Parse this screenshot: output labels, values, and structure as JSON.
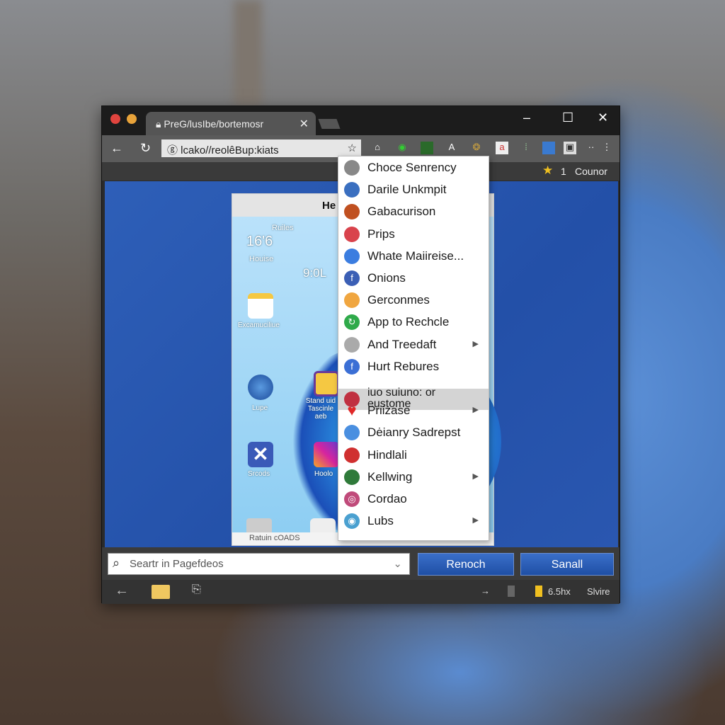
{
  "browser": {
    "tab_title": "PreG/lusIbe/bortemosr",
    "url": "lcako//reolêBup:kiats",
    "bookmark_bar": {
      "star_count": "1",
      "label": "Counor"
    }
  },
  "page": {
    "panel_title": "He",
    "temp": "16'6",
    "temp_label": "Ruiles",
    "place": "Houise",
    "time": "9:0L",
    "apps": [
      "Excamuciliue",
      "Lupe",
      "Stand uid Tascinle aeb",
      "Srcods",
      "Hoolo"
    ],
    "footer_text": "Ratuin cOADS"
  },
  "menu": {
    "items": [
      {
        "label": "Choce Senrency",
        "icon": "gear-icon",
        "color": "#888"
      },
      {
        "label": "Darile Unkmpit",
        "icon": "app-icon",
        "color": "#3a6fc0"
      },
      {
        "label": "Gabacurison",
        "icon": "grid-icon",
        "color": "#c05020"
      },
      {
        "label": "Prips",
        "icon": "circle-icon",
        "color": "#d9434c"
      },
      {
        "label": "Whate Maiireise...",
        "icon": "brush-icon",
        "color": "#3b7de0"
      },
      {
        "label": "Onions",
        "icon": "facebook-icon",
        "color": "#3b5fb5"
      },
      {
        "label": "Gerconmes",
        "icon": "cookie-icon",
        "color": "#f0a640"
      },
      {
        "label": "App to Rechcle",
        "icon": "refresh-icon",
        "color": "#2faa4a"
      },
      {
        "label": "And Treedaft",
        "icon": "doc-icon",
        "color": "#aaa",
        "submenu": true
      },
      {
        "label": "Hurt Rebures",
        "icon": "facebook-icon",
        "color": "#3b6fd5"
      },
      {
        "label": "iuo suiuno: or eustome",
        "icon": "image-icon",
        "color": "#c03040",
        "highlighted": true
      },
      {
        "label": "Priizase",
        "icon": "heart-icon",
        "color": "#e02828",
        "submenu": true
      },
      {
        "label": "Dėianry Sadrepst",
        "icon": "ball-icon",
        "color": "#4a8fe0"
      },
      {
        "label": "Hindlali",
        "icon": "hook-icon",
        "color": "#d03030"
      },
      {
        "label": "Kellwing",
        "icon": "chart-icon",
        "color": "#2f7a3a",
        "submenu": true
      },
      {
        "label": "Cordao",
        "icon": "globe-icon",
        "color": "#c04a7a"
      },
      {
        "label": "Lubs",
        "icon": "eye-icon",
        "color": "#4aa0d0",
        "submenu": true
      }
    ]
  },
  "bottom": {
    "search_placeholder": "Seartr in Pagefdeos",
    "button1": "Renoch",
    "button2": "Sanall",
    "status_size": "6.5hx",
    "status_label": "Slvire"
  }
}
